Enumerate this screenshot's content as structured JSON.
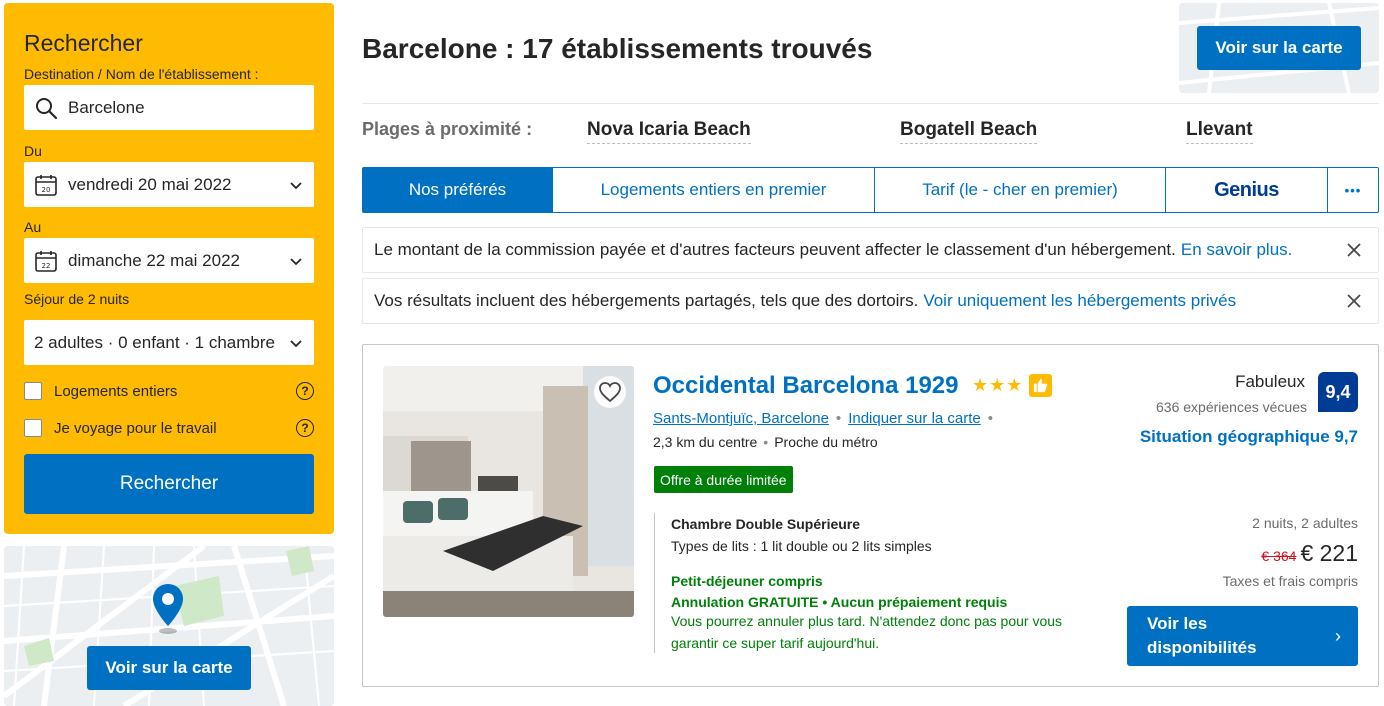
{
  "search": {
    "title": "Rechercher",
    "destination_label": "Destination / Nom de l'établissement :",
    "destination_value": "Barcelone",
    "checkin_label": "Du",
    "checkin_value": "vendredi 20 mai 2022",
    "checkin_day": "20",
    "checkout_label": "Au",
    "checkout_value": "dimanche 22 mai 2022",
    "checkout_day": "22",
    "stay_length": "Séjour de 2 nuits",
    "occupancy": "2 adultes · 0 enfant · 1 chambre",
    "checkbox_entire": "Logements entiers",
    "checkbox_business": "Je voyage pour le travail",
    "help_mark": "?",
    "submit_label": "Rechercher"
  },
  "map": {
    "button_label": "Voir sur la carte"
  },
  "results": {
    "title": "Barcelone : 17 établissements trouvés"
  },
  "beaches": {
    "label": "Plages à proximité :",
    "items": [
      "Nova Icaria Beach",
      "Bogatell Beach",
      "Llevant"
    ]
  },
  "sort_tabs": {
    "items": [
      "Nos préférés",
      "Logements entiers en premier",
      "Tarif (le - cher en premier)",
      "Genius"
    ],
    "more": "•••"
  },
  "notices": {
    "commission_text": "Le montant de la commission payée et d'autres facteurs peuvent affecter le classement d'un hébergement.",
    "commission_link": "En savoir plus.",
    "shared_text": "Vos résultats incluent des hébergements partagés, tels que des dortoirs.",
    "shared_link": "Voir uniquement les hébergements privés"
  },
  "property": {
    "name": "Occidental Barcelona 1929",
    "stars": "★★★",
    "area_link": "Sants-Montjuïc, Barcelone",
    "map_link": "Indiquer sur la carte",
    "distance": "2,3 km du centre",
    "metro": "Proche du métro",
    "deal_badge": "Offre à durée limitée",
    "room_name": "Chambre Double Supérieure",
    "bed_types": "Types de lits : 1 lit double ou 2 lits simples",
    "breakfast": "Petit-déjeuner compris",
    "cancellation": "Annulation GRATUITE • Aucun prépaiement requis",
    "cancellation_note": "Vous pourrez annuler plus tard. N'attendez donc pas pour vous garantir ce super tarif aujourd'hui.",
    "review_word": "Fabuleux",
    "review_count": "636 expériences vécues",
    "score": "9,4",
    "location_score": "Situation géographique 9,7",
    "stay_info": "2 nuits, 2 adultes",
    "old_price": "€ 364",
    "new_price": "€ 221",
    "taxes": "Taxes et frais compris",
    "availability_button": "Voir les disponibilités",
    "arrow": "›"
  },
  "colors": {
    "brand_blue": "#0071c2",
    "dark_blue": "#003b95",
    "yellow": "#febb02",
    "green": "#008009",
    "red": "#d4111e"
  }
}
